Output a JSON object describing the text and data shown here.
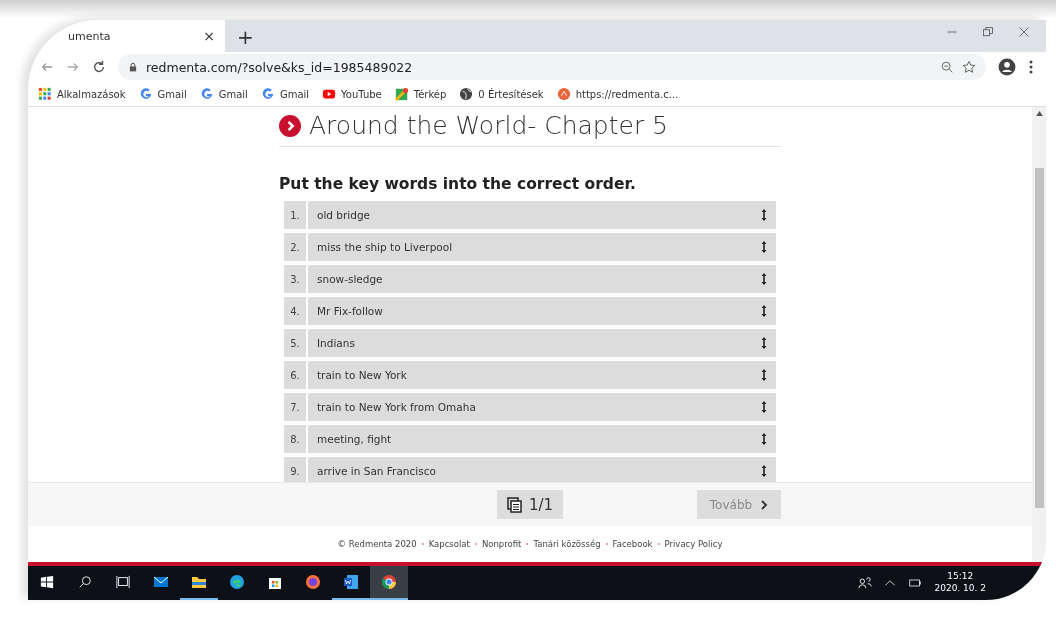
{
  "browser": {
    "tab": {
      "title": "umenta",
      "close": "×",
      "new_tab": "+"
    },
    "url": "redmenta.com/?solve&ks_id=1985489022",
    "bookmarks": [
      {
        "kind": "apps",
        "label": "Alkalmazások"
      },
      {
        "kind": "google",
        "label": "Gmail"
      },
      {
        "kind": "google",
        "label": "Gmail"
      },
      {
        "kind": "google",
        "label": "Gmail"
      },
      {
        "kind": "youtube",
        "label": "YouTube"
      },
      {
        "kind": "maps",
        "label": "Térkép"
      },
      {
        "kind": "globe",
        "label": "0 Értesítések"
      },
      {
        "kind": "redmenta",
        "label": "https://redmenta.c..."
      }
    ]
  },
  "page": {
    "title": "Around the World- Chapter 5",
    "instruction": "Put the key words into the correct order.",
    "items": [
      {
        "number": "1.",
        "text": "old bridge"
      },
      {
        "number": "2.",
        "text": "miss the ship to Liverpool"
      },
      {
        "number": "3.",
        "text": "snow-sledge"
      },
      {
        "number": "4.",
        "text": "Mr Fix-follow"
      },
      {
        "number": "5.",
        "text": "Indians"
      },
      {
        "number": "6.",
        "text": "train to New York"
      },
      {
        "number": "7.",
        "text": "train to New York from Omaha"
      },
      {
        "number": "8.",
        "text": "meeting, fight"
      },
      {
        "number": "9.",
        "text": "arrive in San Francisco"
      }
    ],
    "pager": "1/1",
    "next": "Tovább",
    "copyright": "© Redmenta 2020",
    "footer_links": [
      "Kapcsolat",
      "Nonprofit",
      "Tanári közösség",
      "Facebook",
      "Privacy Policy"
    ]
  },
  "taskbar": {
    "apps": [
      {
        "kind": "start",
        "running": false,
        "selected": false
      },
      {
        "kind": "search",
        "running": false,
        "selected": false
      },
      {
        "kind": "taskview",
        "running": false,
        "selected": false
      },
      {
        "kind": "mail",
        "running": false,
        "selected": false
      },
      {
        "kind": "folder",
        "running": true,
        "selected": false
      },
      {
        "kind": "edge",
        "running": false,
        "selected": false
      },
      {
        "kind": "store",
        "running": false,
        "selected": false
      },
      {
        "kind": "firefox",
        "running": false,
        "selected": false
      },
      {
        "kind": "word",
        "running": true,
        "selected": false
      },
      {
        "kind": "chrome",
        "running": true,
        "selected": true
      }
    ],
    "time": "15:12",
    "date": "2020. 10. 2"
  }
}
